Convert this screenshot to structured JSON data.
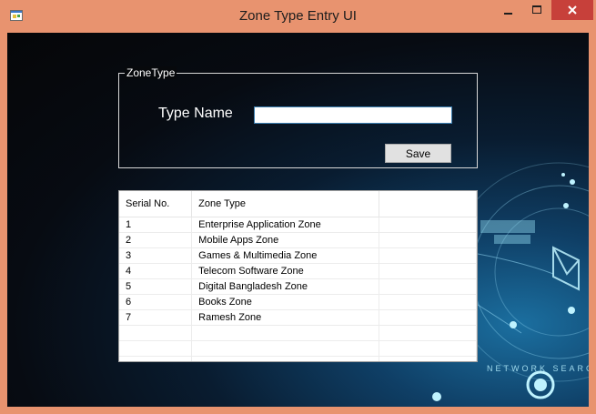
{
  "window": {
    "title": "Zone Type Entry UI",
    "icon": "winforms-app-icon",
    "controls": [
      "minimize-icon",
      "maximize-icon",
      "close-icon"
    ]
  },
  "form": {
    "group_title": "ZoneType",
    "type_name_label": "Type Name",
    "type_name_value": "",
    "save_label": "Save"
  },
  "grid": {
    "columns": [
      "Serial No.",
      "Zone Type",
      ""
    ],
    "rows": [
      [
        "1",
        "Enterprise Application Zone"
      ],
      [
        "2",
        "Mobile Apps Zone"
      ],
      [
        "3",
        "Games & Multimedia Zone"
      ],
      [
        "4",
        "Telecom Software Zone"
      ],
      [
        "5",
        "Digital Bangladesh Zone"
      ],
      [
        "6",
        "Books Zone"
      ],
      [
        "7",
        "Ramesh Zone"
      ],
      [
        "",
        ""
      ],
      [
        "",
        ""
      ],
      [
        "",
        ""
      ]
    ]
  },
  "background": {
    "watermark_text": "NETWORK SEARC"
  },
  "colors": {
    "titlebar": "#e8936f",
    "close_button": "#c7403a",
    "input_border": "#3c7fb1"
  }
}
